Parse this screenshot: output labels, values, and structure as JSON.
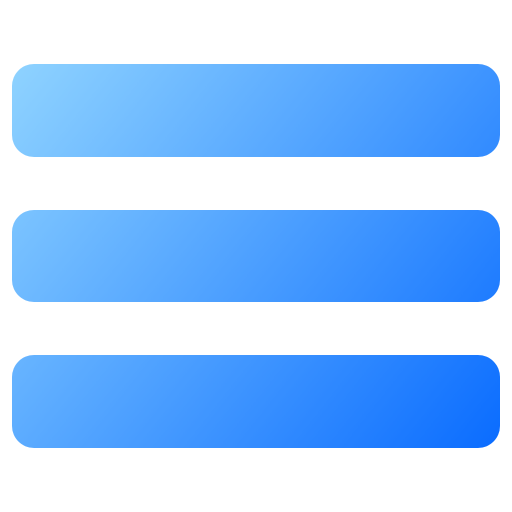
{
  "icon": {
    "name": "hamburger-menu-icon",
    "bar_count": 3
  },
  "colors": {
    "gradient_start": "#8fd3ff",
    "gradient_end": "#0a6cff",
    "background": "#ffffff"
  }
}
